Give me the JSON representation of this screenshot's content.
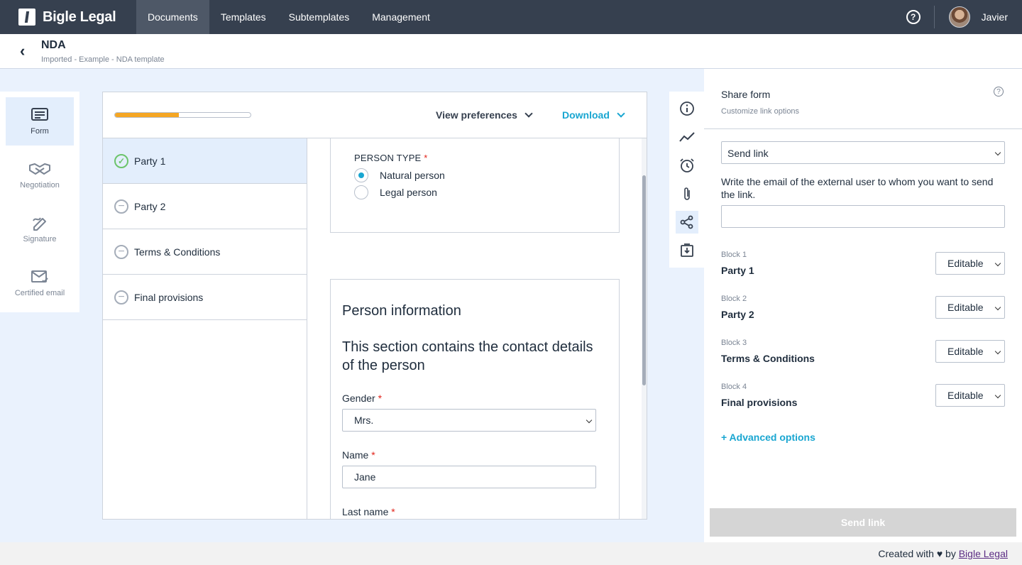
{
  "app": {
    "brand": "Bigle Legal",
    "user": "Javier"
  },
  "nav": {
    "items": [
      {
        "label": "Documents"
      },
      {
        "label": "Templates"
      },
      {
        "label": "Subtemplates"
      },
      {
        "label": "Management"
      }
    ],
    "active": "Documents"
  },
  "header": {
    "title": "NDA",
    "subtitle": "Imported - Example - NDA template"
  },
  "left_rail": {
    "items": [
      {
        "label": "Form"
      },
      {
        "label": "Negotiation"
      },
      {
        "label": "Signature"
      },
      {
        "label": "Certified email"
      }
    ]
  },
  "form_toolbar": {
    "progress": 0.47,
    "view_preferences": "View preferences",
    "download": "Download"
  },
  "blocks": [
    {
      "label": "Party 1",
      "status": "complete"
    },
    {
      "label": "Party 2",
      "status": "pending"
    },
    {
      "label": "Terms & Conditions",
      "status": "pending"
    },
    {
      "label": "Final provisions",
      "status": "pending"
    }
  ],
  "form": {
    "person_type": {
      "label": "PERSON TYPE",
      "required": "*",
      "options": [
        "Natural person",
        "Legal person"
      ],
      "selected": "Natural person"
    },
    "section_title": "Person information",
    "section_desc": "This section contains the contact details of the person",
    "gender": {
      "label": "Gender",
      "required": "*",
      "value": "Mrs."
    },
    "name": {
      "label": "Name",
      "required": "*",
      "value": "Jane"
    },
    "last_name": {
      "label": "Last name",
      "required": "*"
    }
  },
  "tool_rail": {
    "icons": [
      "info-icon",
      "activity-icon",
      "alarm-icon",
      "attachment-icon",
      "share-icon",
      "download-box-icon"
    ],
    "active": "share-icon"
  },
  "share": {
    "title": "Share form",
    "subtitle": "Customize link options",
    "help": "?",
    "mode": "Send link",
    "description": "Write the email of the external user to whom you want to send the link.",
    "email_value": "",
    "blocks": [
      {
        "label": "Block 1",
        "name": "Party 1",
        "permission": "Editable"
      },
      {
        "label": "Block 2",
        "name": "Party 2",
        "permission": "Editable"
      },
      {
        "label": "Block 3",
        "name": "Terms & Conditions",
        "permission": "Editable"
      },
      {
        "label": "Block 4",
        "name": "Final provisions",
        "permission": "Editable"
      }
    ],
    "advanced": "+ Advanced options",
    "send_button": "Send link"
  },
  "footer": {
    "text": "Created with ♥ by",
    "link": "Bigle Legal"
  },
  "colors": {
    "nav_bg": "#36404f",
    "accent": "#19a6d1",
    "progress": "#f5a623",
    "success": "#6cc46b",
    "required": "#e2231a"
  }
}
